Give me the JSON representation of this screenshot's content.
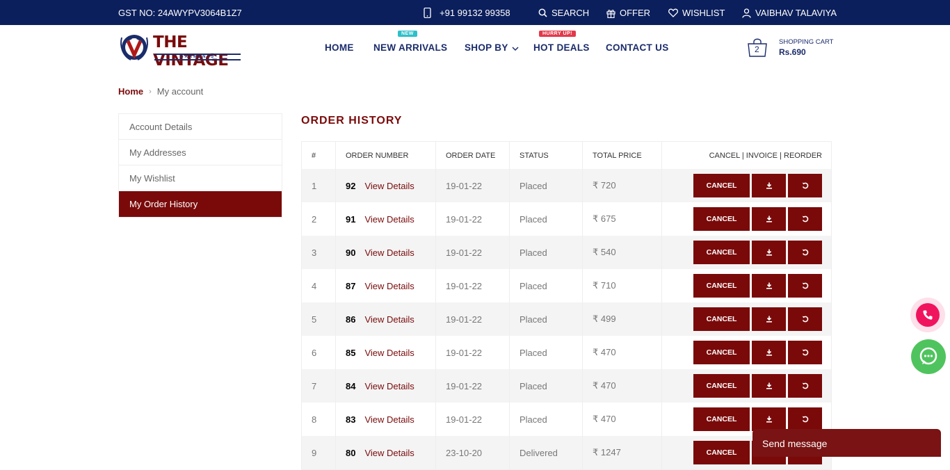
{
  "topbar": {
    "gst": "GST NO: 24AWYPV3064B1Z7",
    "phone": "+91 99132 99358",
    "search": "SEARCH",
    "offer": "OFFER",
    "wishlist": "WISHLIST",
    "user": "VAIBHAV TALAVIYA"
  },
  "logo": {
    "brand": "THE VINTAGE",
    "sub": "GARMENTS"
  },
  "nav": {
    "home": "HOME",
    "new_arrivals": "NEW ARRIVALS",
    "new_badge": "NEW",
    "shop_by": "SHOP BY",
    "hot_deals": "HOT DEALS",
    "hot_badge": "HURRY UP!",
    "contact": "CONTACT US"
  },
  "cart": {
    "count": "2",
    "label": "SHOPPING CART",
    "total": "Rs.690"
  },
  "breadcrumb": {
    "home": "Home",
    "sep": "›",
    "current": "My account"
  },
  "sidebar": {
    "items": [
      {
        "label": "Account Details"
      },
      {
        "label": "My Addresses"
      },
      {
        "label": "My Wishlist"
      },
      {
        "label": "My Order History"
      }
    ]
  },
  "orders": {
    "title": "ORDER HISTORY",
    "headers": {
      "idx": "#",
      "order_number": "ORDER NUMBER",
      "order_date": "ORDER DATE",
      "status": "STATUS",
      "total": "TOTAL PRICE",
      "actions": "CANCEL | INVOICE | REORDER"
    },
    "view_label": "View Details",
    "cancel_label": "CANCEL",
    "rows": [
      {
        "idx": "1",
        "number": "92",
        "date": "19-01-22",
        "status": "Placed",
        "price": "₹ 720"
      },
      {
        "idx": "2",
        "number": "91",
        "date": "19-01-22",
        "status": "Placed",
        "price": "₹ 675"
      },
      {
        "idx": "3",
        "number": "90",
        "date": "19-01-22",
        "status": "Placed",
        "price": "₹ 540"
      },
      {
        "idx": "4",
        "number": "87",
        "date": "19-01-22",
        "status": "Placed",
        "price": "₹ 710"
      },
      {
        "idx": "5",
        "number": "86",
        "date": "19-01-22",
        "status": "Placed",
        "price": "₹ 499"
      },
      {
        "idx": "6",
        "number": "85",
        "date": "19-01-22",
        "status": "Placed",
        "price": "₹ 470"
      },
      {
        "idx": "7",
        "number": "84",
        "date": "19-01-22",
        "status": "Placed",
        "price": "₹ 470"
      },
      {
        "idx": "8",
        "number": "83",
        "date": "19-01-22",
        "status": "Placed",
        "price": "₹ 470"
      },
      {
        "idx": "9",
        "number": "80",
        "date": "23-10-20",
        "status": "Delivered",
        "price": "₹ 1247"
      }
    ]
  },
  "chat": {
    "send_message": "Send message"
  },
  "colors": {
    "primary": "#7a0a0a",
    "topbar": "#0b1f5c",
    "navy": "#1b2c6b",
    "call": "#f0145f",
    "whatsapp": "#4fc45e"
  },
  "icons": [
    "phone-icon",
    "search-icon",
    "gift-icon",
    "heart-icon",
    "user-icon",
    "cart-icon",
    "chevron-down-icon",
    "download-icon",
    "reorder-icon",
    "call-icon",
    "whatsapp-icon"
  ]
}
